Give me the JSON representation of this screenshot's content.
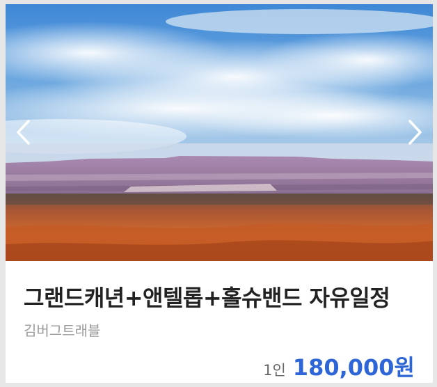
{
  "card": {
    "image_alt": "desert landscape with mesa under blue sky",
    "title": "그랜드캐년+앤텔롭+홀슈밴드 자유일정",
    "vendor": "김버그트래블",
    "price_unit": "1인",
    "price": "180,000원"
  },
  "carousel": {
    "prev_icon": "chevron-left-icon",
    "next_icon": "chevron-right-icon"
  },
  "colors": {
    "accent": "#2e66d8",
    "title": "#222222",
    "vendor": "#9a9a9a",
    "background": "#e6e6e6"
  }
}
